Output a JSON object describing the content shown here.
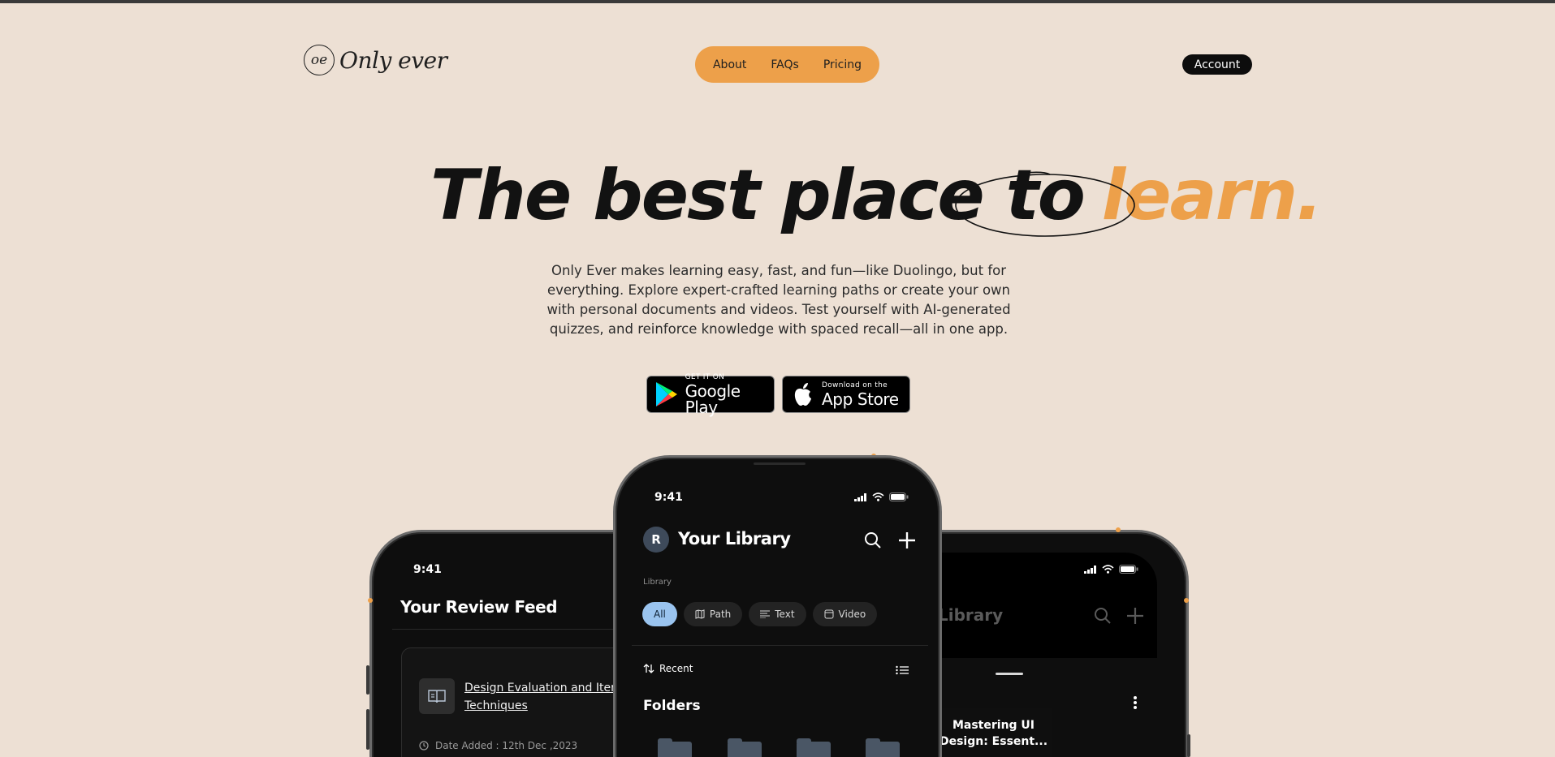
{
  "brand": {
    "logo_mark": "oe",
    "name": "Only ever"
  },
  "nav": {
    "items": [
      "About",
      "FAQs",
      "Pricing"
    ],
    "account_label": "Account"
  },
  "hero": {
    "title_main": "The best place to",
    "title_accent": "learn.",
    "subtitle": "Only Ever makes learning easy, fast, and fun—like Duolingo, but for everything. Explore expert-crafted learning paths or create your own with personal documents and videos. Test yourself with AI-generated quizzes, and reinforce knowledge with spaced recall—all in one app."
  },
  "stores": {
    "google": {
      "small": "GET IT ON",
      "big": "Google Play"
    },
    "apple": {
      "small": "Download on the",
      "big": "App Store"
    }
  },
  "colors": {
    "background": "#ede0d4",
    "accent": "#eda04a",
    "dark": "#0e0e0e",
    "chip_active": "#9ac4ef"
  },
  "phone_left": {
    "time": "9:41",
    "title": "Your Review Feed",
    "card": {
      "title": "Design Evaluation and Iterative Techniques",
      "date": "Date Added : 12th Dec ,2023"
    }
  },
  "phone_center": {
    "time": "9:41",
    "avatar_initial": "R",
    "title": "Your Library",
    "library_label": "Library",
    "chips": [
      {
        "label": "All",
        "icon": "none"
      },
      {
        "label": "Path",
        "icon": "map-icon"
      },
      {
        "label": "Text",
        "icon": "text-lines-icon"
      },
      {
        "label": "Video",
        "icon": "video-icon"
      }
    ],
    "sort_label": "Recent",
    "folders_title": "Folders"
  },
  "phone_right": {
    "title": "Library",
    "course_title": "Mastering UI Design: Essent..."
  }
}
